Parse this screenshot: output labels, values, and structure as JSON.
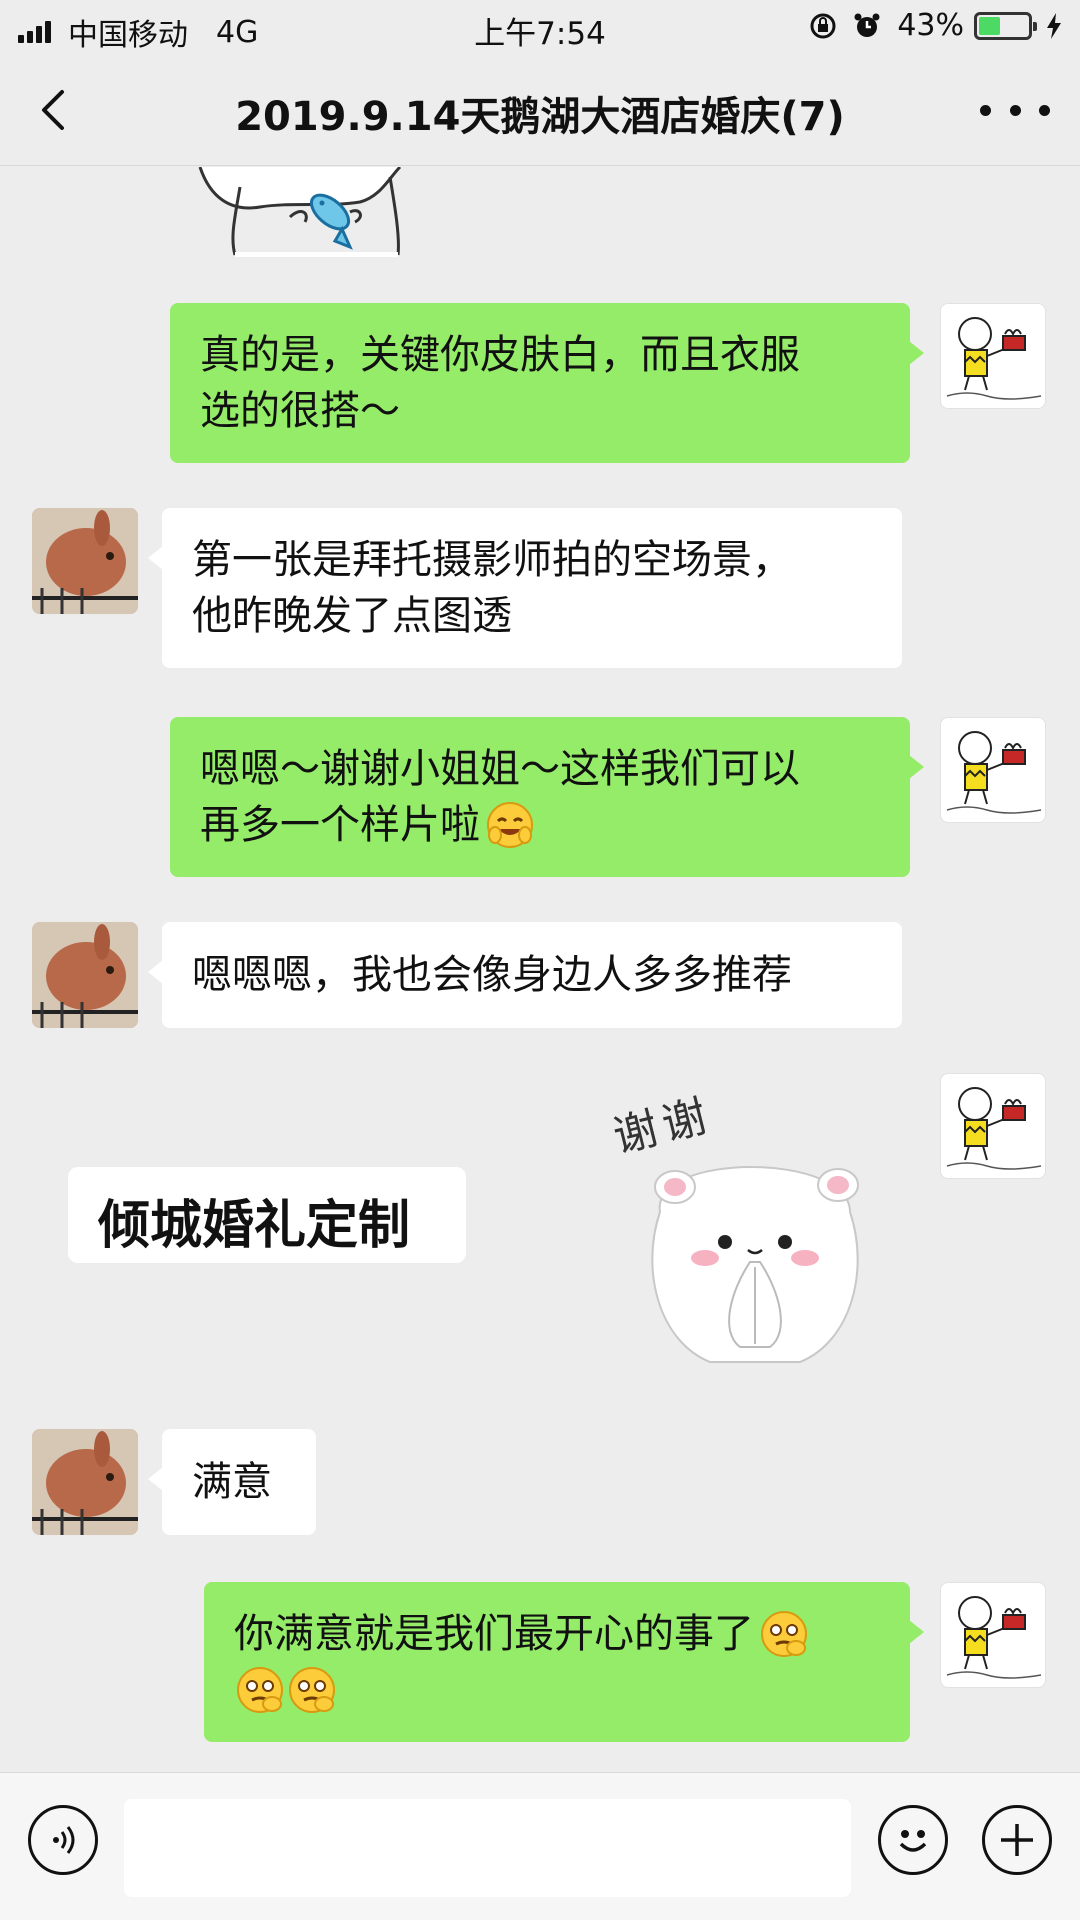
{
  "status_bar": {
    "carrier": "中国移动",
    "network": "4G",
    "time": "上午7:54",
    "battery_text": "43%",
    "battery_level": 0.43
  },
  "nav": {
    "title": "2019.9.14天鹅湖大酒店婚庆(7)"
  },
  "messages": [
    {
      "side": "right",
      "text_line1": "真的是，关键你皮肤白，而且衣服",
      "text_line2": "选的很搭～"
    },
    {
      "side": "left",
      "text_line1": "第一张是拜托摄影师拍的空场景，",
      "text_line2": "他昨晚发了点图透"
    },
    {
      "side": "right",
      "text_line1": "嗯嗯～谢谢小姐姐～这样我们可以",
      "text_line2": "再多一个样片啦"
    },
    {
      "side": "left",
      "text": "嗯嗯嗯，我也会像身边人多多推荐"
    },
    {
      "side": "left",
      "text": "倾城婚礼定制",
      "type": "card"
    },
    {
      "side": "right",
      "type": "sticker",
      "sticker_text": "谢谢"
    },
    {
      "side": "left",
      "text": "满意"
    },
    {
      "side": "right",
      "text_line1": "你满意就是我们最开心的事了"
    }
  ],
  "icons": {
    "back": "chevron-left-icon",
    "more": "more-icon",
    "voice": "voice-icon",
    "emoji": "emoji-icon",
    "plus": "plus-icon"
  },
  "colors": {
    "bubble_sent": "#95ec69",
    "bubble_received": "#ffffff",
    "background": "#ededed"
  }
}
